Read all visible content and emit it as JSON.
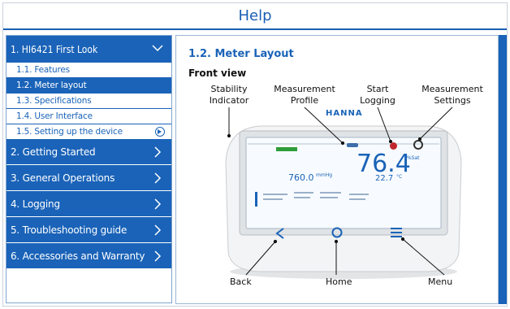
{
  "window": {
    "title": "Help"
  },
  "sidebar": {
    "section_label": "1. HI6421 First Look",
    "sub_items": [
      {
        "label": "1.1. Features"
      },
      {
        "label": "1.2. Meter layout"
      },
      {
        "label": "1.3. Specifications"
      },
      {
        "label": "1.4. User Interface"
      },
      {
        "label": "1.5. Setting up the device"
      }
    ],
    "nav_items": [
      {
        "label": "2. Getting Started"
      },
      {
        "label": "3. General Operations"
      },
      {
        "label": "4. Logging"
      },
      {
        "label": "5. Troubleshooting guide"
      },
      {
        "label": "6. Accessories and Warranty"
      }
    ]
  },
  "content": {
    "heading": "1.2.  Meter Layout",
    "subheading": "Front view",
    "callouts": {
      "stability": "Stability\nIndicator",
      "profile": "Measurement\nProfile",
      "logging": "Start\nLogging",
      "settings": "Measurement\nSettings",
      "back": "Back",
      "home": "Home",
      "menu": "Menu"
    },
    "device": {
      "brand": "HANNA",
      "main_reading": "76.4",
      "main_unit": "%Sat",
      "secondary_reading": "760.0",
      "secondary_unit": "mmHg",
      "temperature": "22.7",
      "temp_unit": "°C"
    }
  },
  "colors": {
    "accent": "#1a63b8",
    "stability_green": "#2e9d3a",
    "log_red": "#c0272d"
  }
}
